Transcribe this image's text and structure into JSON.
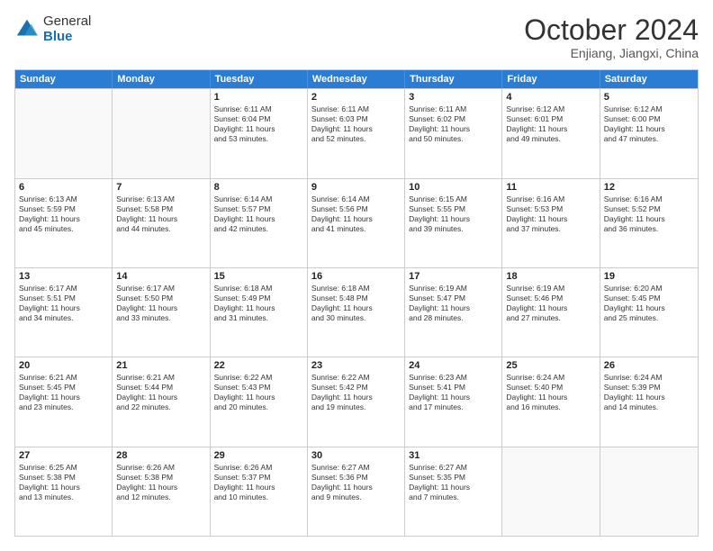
{
  "logo": {
    "general": "General",
    "blue": "Blue"
  },
  "title": "October 2024",
  "subtitle": "Enjiang, Jiangxi, China",
  "headers": [
    "Sunday",
    "Monday",
    "Tuesday",
    "Wednesday",
    "Thursday",
    "Friday",
    "Saturday"
  ],
  "weeks": [
    [
      {
        "day": "",
        "lines": [],
        "empty": true
      },
      {
        "day": "",
        "lines": [],
        "empty": true
      },
      {
        "day": "1",
        "lines": [
          "Sunrise: 6:11 AM",
          "Sunset: 6:04 PM",
          "Daylight: 11 hours",
          "and 53 minutes."
        ]
      },
      {
        "day": "2",
        "lines": [
          "Sunrise: 6:11 AM",
          "Sunset: 6:03 PM",
          "Daylight: 11 hours",
          "and 52 minutes."
        ]
      },
      {
        "day": "3",
        "lines": [
          "Sunrise: 6:11 AM",
          "Sunset: 6:02 PM",
          "Daylight: 11 hours",
          "and 50 minutes."
        ]
      },
      {
        "day": "4",
        "lines": [
          "Sunrise: 6:12 AM",
          "Sunset: 6:01 PM",
          "Daylight: 11 hours",
          "and 49 minutes."
        ]
      },
      {
        "day": "5",
        "lines": [
          "Sunrise: 6:12 AM",
          "Sunset: 6:00 PM",
          "Daylight: 11 hours",
          "and 47 minutes."
        ]
      }
    ],
    [
      {
        "day": "6",
        "lines": [
          "Sunrise: 6:13 AM",
          "Sunset: 5:59 PM",
          "Daylight: 11 hours",
          "and 45 minutes."
        ]
      },
      {
        "day": "7",
        "lines": [
          "Sunrise: 6:13 AM",
          "Sunset: 5:58 PM",
          "Daylight: 11 hours",
          "and 44 minutes."
        ]
      },
      {
        "day": "8",
        "lines": [
          "Sunrise: 6:14 AM",
          "Sunset: 5:57 PM",
          "Daylight: 11 hours",
          "and 42 minutes."
        ]
      },
      {
        "day": "9",
        "lines": [
          "Sunrise: 6:14 AM",
          "Sunset: 5:56 PM",
          "Daylight: 11 hours",
          "and 41 minutes."
        ]
      },
      {
        "day": "10",
        "lines": [
          "Sunrise: 6:15 AM",
          "Sunset: 5:55 PM",
          "Daylight: 11 hours",
          "and 39 minutes."
        ]
      },
      {
        "day": "11",
        "lines": [
          "Sunrise: 6:16 AM",
          "Sunset: 5:53 PM",
          "Daylight: 11 hours",
          "and 37 minutes."
        ]
      },
      {
        "day": "12",
        "lines": [
          "Sunrise: 6:16 AM",
          "Sunset: 5:52 PM",
          "Daylight: 11 hours",
          "and 36 minutes."
        ]
      }
    ],
    [
      {
        "day": "13",
        "lines": [
          "Sunrise: 6:17 AM",
          "Sunset: 5:51 PM",
          "Daylight: 11 hours",
          "and 34 minutes."
        ]
      },
      {
        "day": "14",
        "lines": [
          "Sunrise: 6:17 AM",
          "Sunset: 5:50 PM",
          "Daylight: 11 hours",
          "and 33 minutes."
        ]
      },
      {
        "day": "15",
        "lines": [
          "Sunrise: 6:18 AM",
          "Sunset: 5:49 PM",
          "Daylight: 11 hours",
          "and 31 minutes."
        ]
      },
      {
        "day": "16",
        "lines": [
          "Sunrise: 6:18 AM",
          "Sunset: 5:48 PM",
          "Daylight: 11 hours",
          "and 30 minutes."
        ]
      },
      {
        "day": "17",
        "lines": [
          "Sunrise: 6:19 AM",
          "Sunset: 5:47 PM",
          "Daylight: 11 hours",
          "and 28 minutes."
        ]
      },
      {
        "day": "18",
        "lines": [
          "Sunrise: 6:19 AM",
          "Sunset: 5:46 PM",
          "Daylight: 11 hours",
          "and 27 minutes."
        ]
      },
      {
        "day": "19",
        "lines": [
          "Sunrise: 6:20 AM",
          "Sunset: 5:45 PM",
          "Daylight: 11 hours",
          "and 25 minutes."
        ]
      }
    ],
    [
      {
        "day": "20",
        "lines": [
          "Sunrise: 6:21 AM",
          "Sunset: 5:45 PM",
          "Daylight: 11 hours",
          "and 23 minutes."
        ]
      },
      {
        "day": "21",
        "lines": [
          "Sunrise: 6:21 AM",
          "Sunset: 5:44 PM",
          "Daylight: 11 hours",
          "and 22 minutes."
        ]
      },
      {
        "day": "22",
        "lines": [
          "Sunrise: 6:22 AM",
          "Sunset: 5:43 PM",
          "Daylight: 11 hours",
          "and 20 minutes."
        ]
      },
      {
        "day": "23",
        "lines": [
          "Sunrise: 6:22 AM",
          "Sunset: 5:42 PM",
          "Daylight: 11 hours",
          "and 19 minutes."
        ]
      },
      {
        "day": "24",
        "lines": [
          "Sunrise: 6:23 AM",
          "Sunset: 5:41 PM",
          "Daylight: 11 hours",
          "and 17 minutes."
        ]
      },
      {
        "day": "25",
        "lines": [
          "Sunrise: 6:24 AM",
          "Sunset: 5:40 PM",
          "Daylight: 11 hours",
          "and 16 minutes."
        ]
      },
      {
        "day": "26",
        "lines": [
          "Sunrise: 6:24 AM",
          "Sunset: 5:39 PM",
          "Daylight: 11 hours",
          "and 14 minutes."
        ]
      }
    ],
    [
      {
        "day": "27",
        "lines": [
          "Sunrise: 6:25 AM",
          "Sunset: 5:38 PM",
          "Daylight: 11 hours",
          "and 13 minutes."
        ]
      },
      {
        "day": "28",
        "lines": [
          "Sunrise: 6:26 AM",
          "Sunset: 5:38 PM",
          "Daylight: 11 hours",
          "and 12 minutes."
        ]
      },
      {
        "day": "29",
        "lines": [
          "Sunrise: 6:26 AM",
          "Sunset: 5:37 PM",
          "Daylight: 11 hours",
          "and 10 minutes."
        ]
      },
      {
        "day": "30",
        "lines": [
          "Sunrise: 6:27 AM",
          "Sunset: 5:36 PM",
          "Daylight: 11 hours",
          "and 9 minutes."
        ]
      },
      {
        "day": "31",
        "lines": [
          "Sunrise: 6:27 AM",
          "Sunset: 5:35 PM",
          "Daylight: 11 hours",
          "and 7 minutes."
        ]
      },
      {
        "day": "",
        "lines": [],
        "empty": true
      },
      {
        "day": "",
        "lines": [],
        "empty": true
      }
    ]
  ]
}
